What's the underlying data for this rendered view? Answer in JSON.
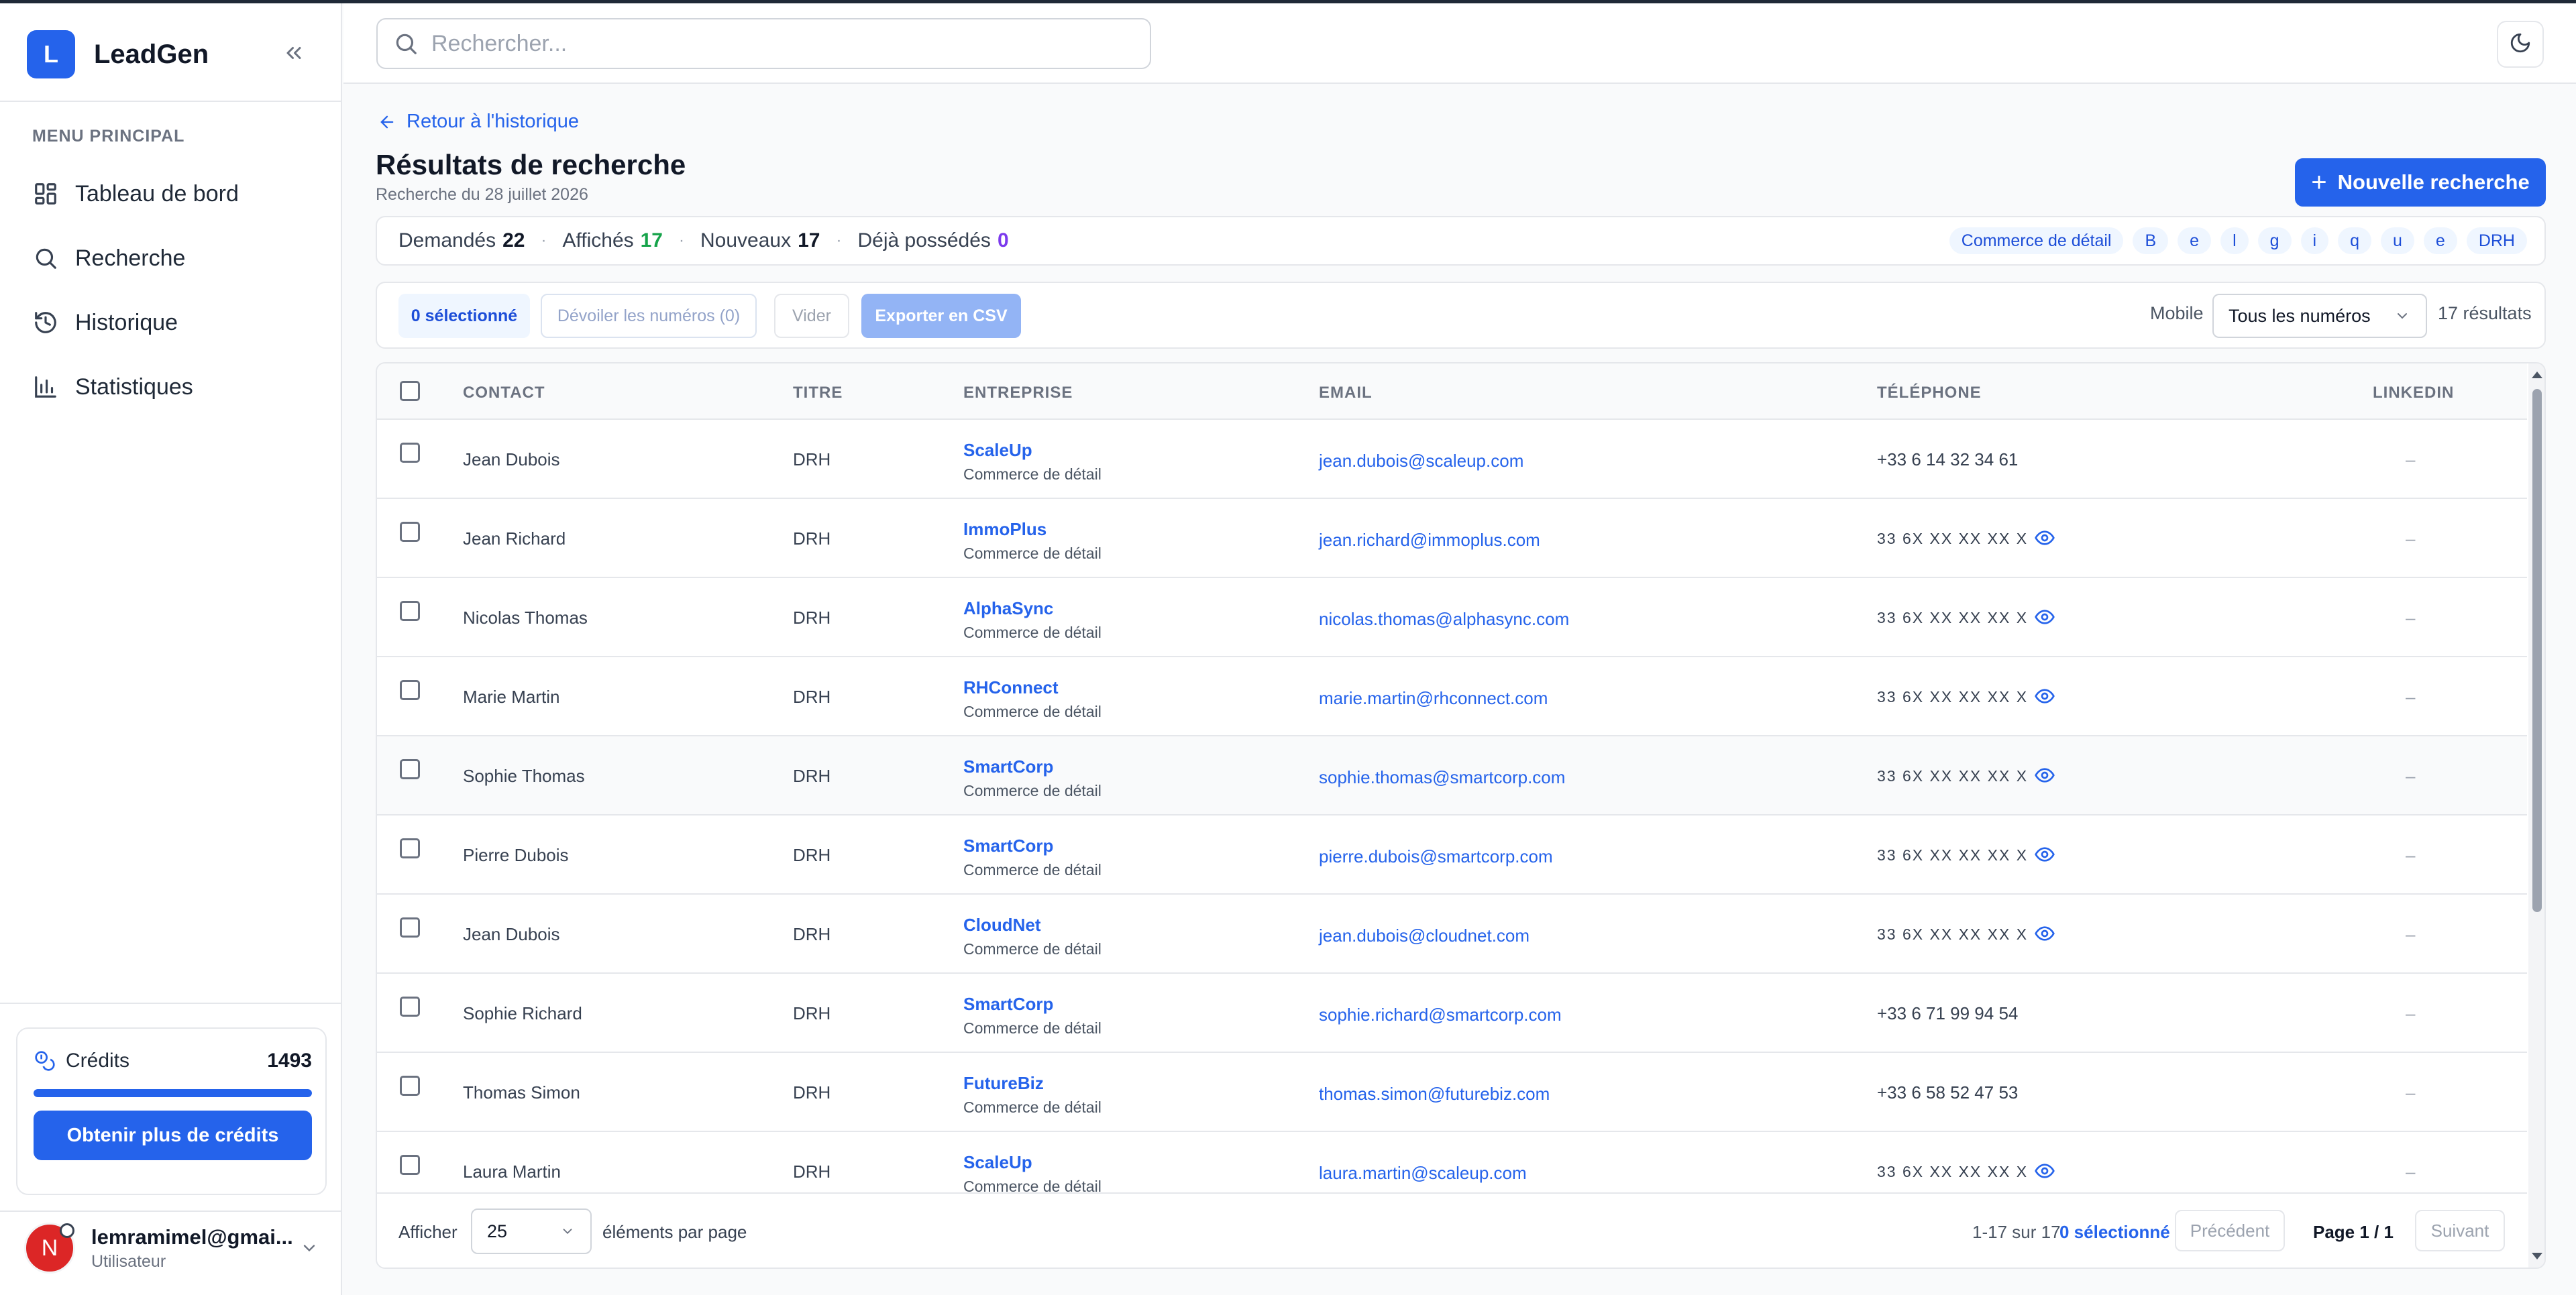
{
  "app": {
    "logo_letter": "L",
    "name": "LeadGen"
  },
  "sidebar": {
    "menu_title": "MENU PRINCIPAL",
    "items": [
      {
        "label": "Tableau de bord",
        "icon": "dashboard-icon"
      },
      {
        "label": "Recherche",
        "icon": "search-icon"
      },
      {
        "label": "Historique",
        "icon": "history-icon"
      },
      {
        "label": "Statistiques",
        "icon": "chart-icon"
      }
    ],
    "credits": {
      "label": "Crédits",
      "value": "1493",
      "fill_percent": 100,
      "button": "Obtenir plus de crédits"
    },
    "user": {
      "initial": "N",
      "email": "lemramimel@gmai...",
      "role": "Utilisateur"
    }
  },
  "topbar": {
    "search_placeholder": "Rechercher..."
  },
  "header": {
    "back_link": "Retour à l'historique",
    "title": "Résultats de recherche",
    "subtitle": "Recherche du 28 juillet 2026",
    "new_search": "Nouvelle recherche"
  },
  "stats": [
    {
      "label": "Demandés",
      "value": "22",
      "color": "#111827"
    },
    {
      "label": "Affichés",
      "value": "17",
      "color": "#16a34a"
    },
    {
      "label": "Nouveaux",
      "value": "17",
      "color": "#111827"
    },
    {
      "label": "Déjà possédés",
      "value": "0",
      "color": "#7c3aed"
    }
  ],
  "tags": [
    "Commerce de détail",
    "B",
    "e",
    "l",
    "g",
    "i",
    "q",
    "u",
    "e",
    "DRH"
  ],
  "toolbar": {
    "selected": "0 sélectionné",
    "reveal": "Dévoiler les numéros (0)",
    "clear": "Vider",
    "export": "Exporter en CSV",
    "filter_label": "Mobile",
    "filter_value": "Tous les numéros",
    "result_count": "17 résultats"
  },
  "table": {
    "headers": {
      "contact": "CONTACT",
      "title": "TITRE",
      "company": "ENTREPRISE",
      "email": "EMAIL",
      "phone": "TÉLÉPHONE",
      "linkedin": "LINKEDIN"
    },
    "rows": [
      {
        "contact": "Jean Dubois",
        "title": "DRH",
        "company": "ScaleUp",
        "sector": "Commerce de détail",
        "email": "jean.dubois@scaleup.com",
        "phone": "+33 6 14 32 34 61",
        "masked": false,
        "linkedin": "–"
      },
      {
        "contact": "Jean Richard",
        "title": "DRH",
        "company": "ImmoPlus",
        "sector": "Commerce de détail",
        "email": "jean.richard@immoplus.com",
        "phone": "33 6X XX XX XX X",
        "masked": true,
        "linkedin": "–"
      },
      {
        "contact": "Nicolas Thomas",
        "title": "DRH",
        "company": "AlphaSync",
        "sector": "Commerce de détail",
        "email": "nicolas.thomas@alphasync.com",
        "phone": "33 6X XX XX XX X",
        "masked": true,
        "linkedin": "–"
      },
      {
        "contact": "Marie Martin",
        "title": "DRH",
        "company": "RHConnect",
        "sector": "Commerce de détail",
        "email": "marie.martin@rhconnect.com",
        "phone": "33 6X XX XX XX X",
        "masked": true,
        "linkedin": "–"
      },
      {
        "contact": "Sophie Thomas",
        "title": "DRH",
        "company": "SmartCorp",
        "sector": "Commerce de détail",
        "email": "sophie.thomas@smartcorp.com",
        "phone": "33 6X XX XX XX X",
        "masked": true,
        "linkedin": "–"
      },
      {
        "contact": "Pierre Dubois",
        "title": "DRH",
        "company": "SmartCorp",
        "sector": "Commerce de détail",
        "email": "pierre.dubois@smartcorp.com",
        "phone": "33 6X XX XX XX X",
        "masked": true,
        "linkedin": "–"
      },
      {
        "contact": "Jean Dubois",
        "title": "DRH",
        "company": "CloudNet",
        "sector": "Commerce de détail",
        "email": "jean.dubois@cloudnet.com",
        "phone": "33 6X XX XX XX X",
        "masked": true,
        "linkedin": "–"
      },
      {
        "contact": "Sophie Richard",
        "title": "DRH",
        "company": "SmartCorp",
        "sector": "Commerce de détail",
        "email": "sophie.richard@smartcorp.com",
        "phone": "+33 6 71 99 94 54",
        "masked": false,
        "linkedin": "–"
      },
      {
        "contact": "Thomas Simon",
        "title": "DRH",
        "company": "FutureBiz",
        "sector": "Commerce de détail",
        "email": "thomas.simon@futurebiz.com",
        "phone": "+33 6 58 52 47 53",
        "masked": false,
        "linkedin": "–"
      },
      {
        "contact": "Laura Martin",
        "title": "DRH",
        "company": "ScaleUp",
        "sector": "Commerce de détail",
        "email": "laura.martin@scaleup.com",
        "phone": "33 6X XX XX XX X",
        "masked": true,
        "linkedin": "–"
      }
    ]
  },
  "footer": {
    "show_label": "Afficher",
    "per_page": "25",
    "per_page_suffix": "éléments par page",
    "range": "1-17 sur 17",
    "selected": "0 sélectionné",
    "prev": "Précédent",
    "page": "Page 1 / 1",
    "next": "Suivant"
  }
}
